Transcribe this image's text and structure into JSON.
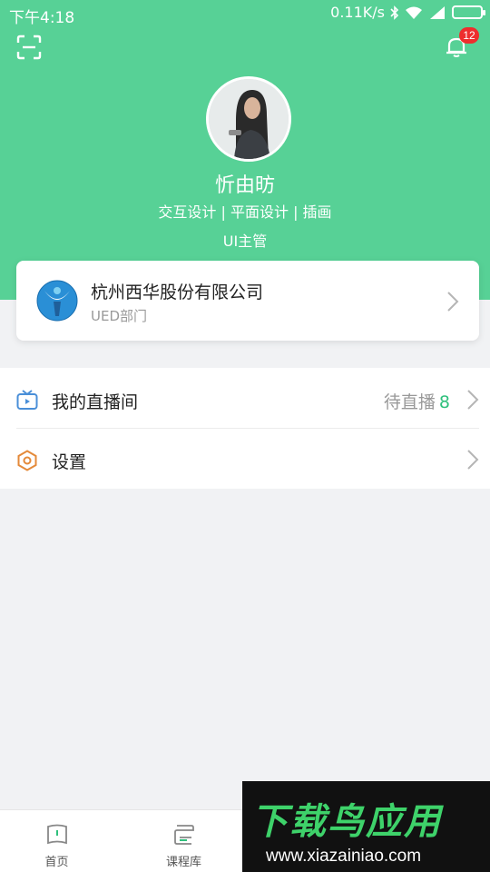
{
  "status_bar": {
    "time": "下午4:18",
    "speed": "0.11K/s"
  },
  "header": {
    "notification_count": "12",
    "icons": {
      "scan": "scan-icon",
      "bell": "bell-icon"
    }
  },
  "profile": {
    "name": "忻由昉",
    "tags": "交互设计 | 平面设计 | 插画",
    "role": "UI主管"
  },
  "company": {
    "name": "杭州西华股份有限公司",
    "department": "UED部门"
  },
  "menu": {
    "live": {
      "label": "我的直播间",
      "pending_label": "待直播",
      "pending_count": "8"
    },
    "settings": {
      "label": "设置"
    }
  },
  "tabs": [
    {
      "label": "首页",
      "icon": "home-icon"
    },
    {
      "label": "课程库",
      "icon": "course-library-icon"
    }
  ],
  "watermark": {
    "title": "下载鸟应用",
    "url": "www.xiazainiao.com"
  },
  "colors": {
    "brand": "#57d196",
    "accent_count": "#2fc07c",
    "badge": "#ee2d2d",
    "live_icon": "#4a8fd8",
    "settings_icon": "#e48a3a"
  }
}
